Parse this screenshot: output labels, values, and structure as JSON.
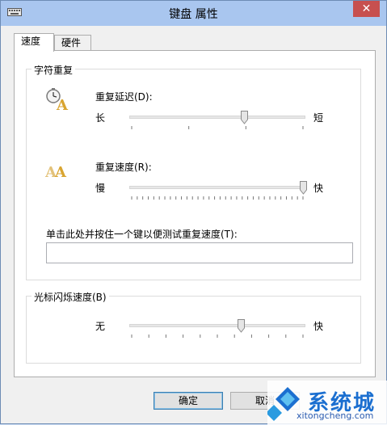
{
  "window": {
    "title": "键盘 属性",
    "close_symbol": "✕"
  },
  "tabs": [
    {
      "label": "速度",
      "active": true
    },
    {
      "label": "硬件",
      "active": false
    }
  ],
  "character_repeat": {
    "group_title": "字符重复",
    "repeat_delay": {
      "label": "重复延迟(D):",
      "min_label": "长",
      "max_label": "短",
      "tick_count": 4,
      "value_fraction": 0.66
    },
    "repeat_rate": {
      "label": "重复速度(R):",
      "min_label": "慢",
      "max_label": "快",
      "tick_count": 32,
      "value_fraction": 1.0
    },
    "test_field": {
      "label": "单击此处并按住一个键以便测试重复速度(T):",
      "value": ""
    }
  },
  "cursor_blink": {
    "group_title": "光标闪烁速度(B)",
    "min_label": "无",
    "max_label": "快",
    "tick_count": 11,
    "value_fraction": 0.64
  },
  "buttons": {
    "ok": "确定",
    "cancel": "取消"
  },
  "watermark": {
    "text": "系统城",
    "url": "xitongcheng.com"
  },
  "colors": {
    "titlebar": "#a9c6ef",
    "close": "#c7504f",
    "accent": "#1b6fd0"
  }
}
